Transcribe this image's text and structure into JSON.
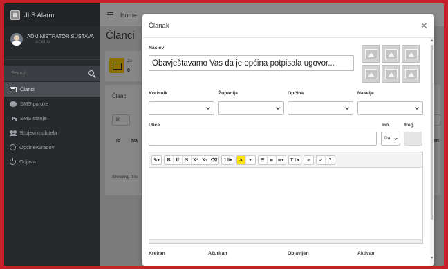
{
  "brand": {
    "title": "JLS Alarm"
  },
  "user": {
    "name": "ADMINISTRATOR SUSTAVA",
    "role": "ADMIN"
  },
  "sidebar": {
    "search_placeholder": "Search",
    "items": [
      {
        "label": "Članci",
        "icon": "newspaper-icon",
        "active": true
      },
      {
        "label": "SMS poruke",
        "icon": "chat-icon"
      },
      {
        "label": "SMS stanje",
        "icon": "chart-icon"
      },
      {
        "label": "Brojevi mobitela",
        "icon": "users-icon"
      },
      {
        "label": "Općine/Gradovi",
        "icon": "globe-icon"
      },
      {
        "label": "Odjava",
        "icon": "power-icon"
      }
    ]
  },
  "topbar": {
    "home": "Home"
  },
  "page": {
    "title": "Članci",
    "info_label": "Za",
    "info_count": "0",
    "panel_title": "Članci",
    "length_value": "10",
    "col_id": "Id",
    "col_na": "Na",
    "col_right": "jen",
    "showing": "Showing 0 to"
  },
  "modal": {
    "title": "Članak",
    "naslov_label": "Naslov",
    "naslov_value": "Obavještavamo Vas da je općina potpisala ugovor...",
    "korisnik_label": "Korisnik",
    "zupanija_label": "Županija",
    "opcina_label": "Općina",
    "naselje_label": "Naselje",
    "ulice_label": "Ulice",
    "ino_label": "Ino",
    "reg_label": "Reg",
    "ino_value": "Da",
    "toolbar": {
      "magic": "✎▾",
      "bold": "B",
      "underline": "U",
      "strike": "S",
      "superscript": "X²",
      "subscript": "X₂",
      "eraser": "⌫",
      "font_size": "16▾",
      "color": "A",
      "color_caret": "▾",
      "ul": "☰",
      "ol": "≣",
      "align": "≡▾",
      "height": "T↕▾",
      "link": "⊘",
      "fullscreen": "⤢",
      "help": "?"
    },
    "kreiran_label": "Kreiran",
    "azuriran_label": "Ažuriran",
    "objavljen_label": "Objavljen",
    "aktivan_label": "Aktivan"
  }
}
